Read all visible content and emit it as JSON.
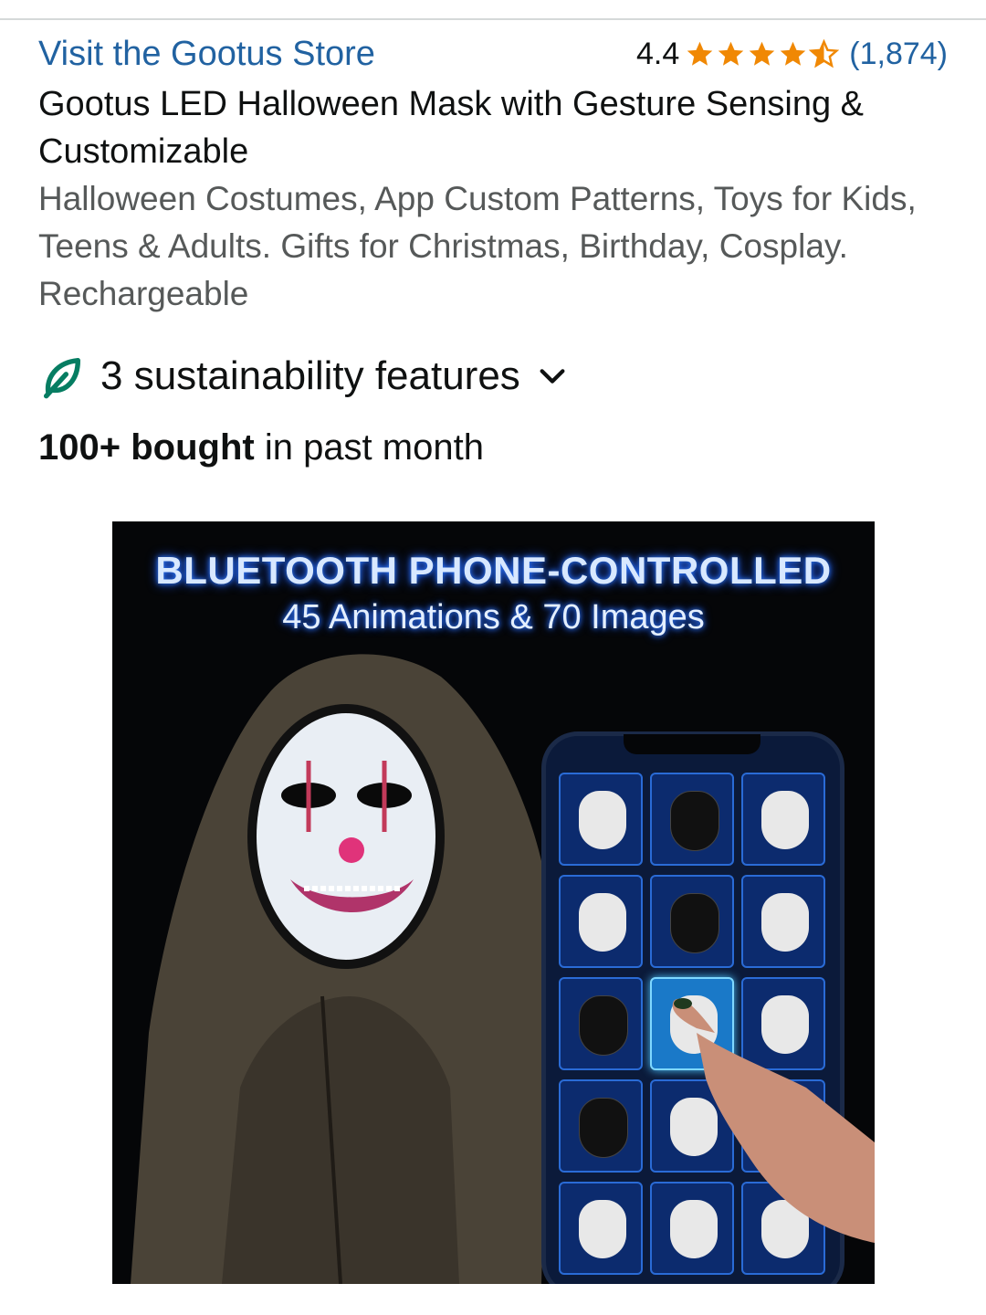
{
  "store": {
    "link_text": "Visit the Gootus Store"
  },
  "rating": {
    "value": "4.4",
    "stars": 4.4,
    "count_text": "(1,874)",
    "star_color": "#f08804"
  },
  "product": {
    "title": "Gootus LED Halloween Mask with Gesture Sensing & Customizable",
    "subtitle": "Halloween Costumes, App Custom Patterns, Toys for Kids, Teens & Adults. Gifts for Christmas, Birthday, Cosplay. Rechargeable"
  },
  "sustainability": {
    "label": "3 sustainability features",
    "icon": "leaf-icon",
    "accent": "#067d62"
  },
  "sales": {
    "bold": "100+ bought",
    "rest": " in past month"
  },
  "image": {
    "headline": "BLUETOOTH PHONE-CONTROLLED",
    "subline": "45 Animations & 70 Images"
  },
  "colors": {
    "link": "#2162a1",
    "text": "#0f1111",
    "muted": "#565959"
  }
}
